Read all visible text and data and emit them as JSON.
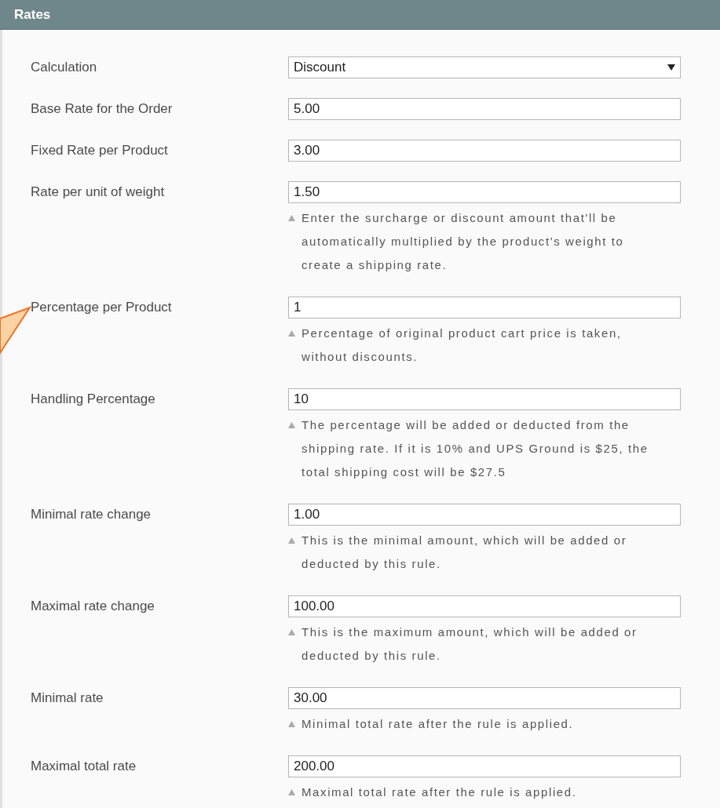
{
  "section": {
    "title": "Rates"
  },
  "fields": [
    {
      "kind": "select",
      "label": "Calculation",
      "value": "Discount"
    },
    {
      "kind": "text",
      "label": "Base Rate for the Order",
      "value": "5.00"
    },
    {
      "kind": "text",
      "label": "Fixed Rate per Product",
      "value": "3.00"
    },
    {
      "kind": "text",
      "label": "Rate per unit of weight",
      "value": "1.50",
      "note": "Enter the surcharge or discount amount that'll be automatically multiplied by the product's weight to create a shipping rate."
    },
    {
      "kind": "text",
      "label": "Percentage per Product",
      "value": "1",
      "note": "Percentage of original product cart price is taken, without discounts.",
      "callout": true
    },
    {
      "kind": "text",
      "label": "Handling Percentage",
      "value": "10",
      "note": "The percentage will be added or deducted from the shipping rate. If it is 10% and UPS Ground is $25, the total shipping cost will be $27.5"
    },
    {
      "kind": "text",
      "label": "Minimal rate change",
      "value": "1.00",
      "note": "This is the minimal amount, which will be added or deducted by this rule."
    },
    {
      "kind": "text",
      "label": "Maximal rate change",
      "value": "100.00",
      "note": "This is the maximum amount, which will be added or deducted by this rule."
    },
    {
      "kind": "text",
      "label": "Minimal rate",
      "value": "30.00",
      "note": "Minimal total rate after the rule is applied."
    },
    {
      "kind": "text",
      "label": "Maximal total rate",
      "value": "200.00",
      "note": "Maximal total rate after the rule is applied."
    }
  ]
}
